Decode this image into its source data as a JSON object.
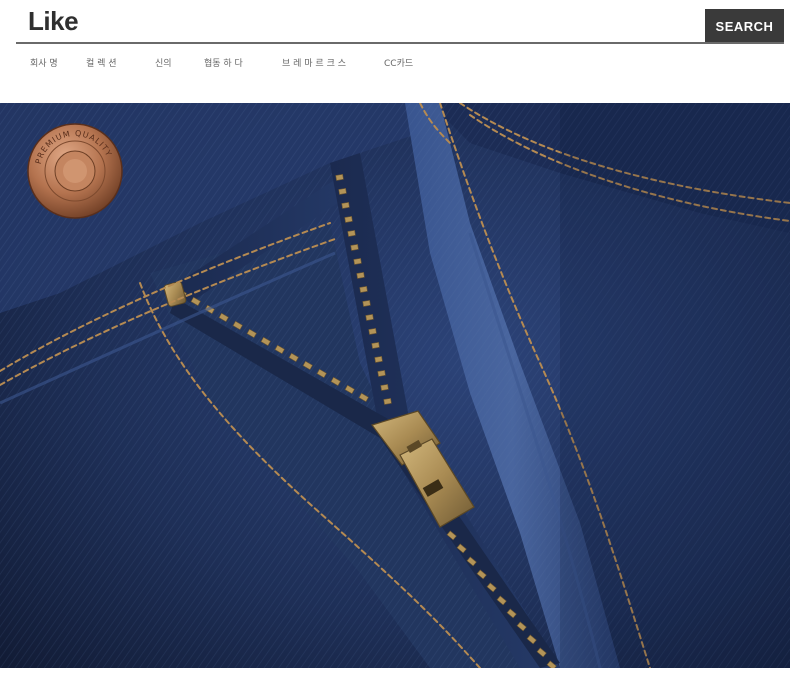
{
  "header": {
    "logo": "Like",
    "search_label": "SEARCH"
  },
  "nav": {
    "items": [
      {
        "label": "회사 명"
      },
      {
        "label": "컬 렉 션"
      },
      {
        "label": "신의"
      },
      {
        "label": "협동 하 다"
      },
      {
        "label": "브 레 마 르 크 스"
      },
      {
        "label": "CC카드"
      }
    ]
  },
  "photo": {
    "button_text": "PREMIUM QUALITY",
    "colors": {
      "denim_dark": "#16223f",
      "denim_mid": "#243867",
      "denim_light": "#3a5487",
      "stitch": "#b58a52",
      "brass": "#a88a52",
      "button_copper": "#b57a55"
    }
  }
}
